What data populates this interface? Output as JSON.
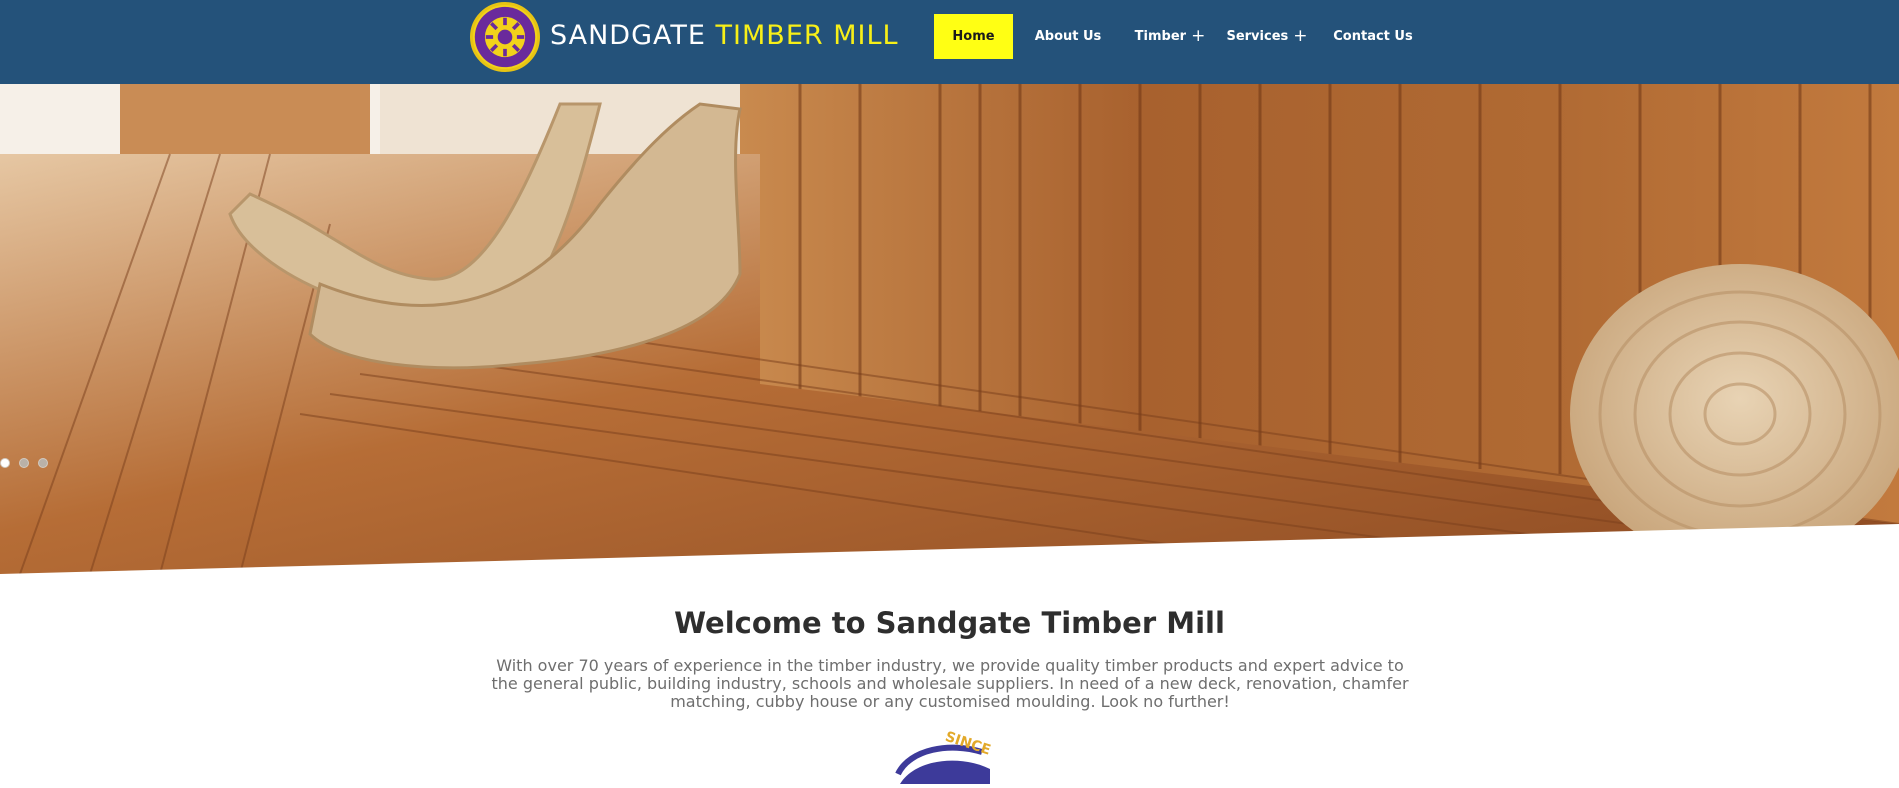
{
  "brand": {
    "name_part1": "SANDGATE",
    "name_part2": "TIMBER MILL",
    "primary_color": "#24527a",
    "accent_color": "#f7ef18"
  },
  "logo": {
    "icon": "sandgate-timber-mill-seal-icon",
    "text_top": "SANDGATE",
    "text_bottom": "TIMBER MILL"
  },
  "nav": {
    "items": [
      {
        "label": "Home",
        "active": true,
        "has_submenu": false
      },
      {
        "label": "About Us",
        "active": false,
        "has_submenu": false
      },
      {
        "label": "Timber",
        "active": false,
        "has_submenu": true
      },
      {
        "label": "Services",
        "active": false,
        "has_submenu": true
      },
      {
        "label": "Contact Us",
        "active": false,
        "has_submenu": false
      }
    ],
    "submenu_icon": "plus-icon"
  },
  "hero": {
    "image": "timber-deck-lounge-photo",
    "slide_count": 3,
    "active_slide": 1
  },
  "welcome": {
    "title": "Welcome to Sandgate Timber Mill",
    "text": "With over 70 years of experience in the timber industry, we provide quality timber products and expert advice to the general public, building industry, schools and wholesale suppliers. In need of a new deck, renovation, chamfer matching, cubby house or any customised moulding. Look no further!"
  },
  "since_badge": {
    "text": "SINCE"
  }
}
